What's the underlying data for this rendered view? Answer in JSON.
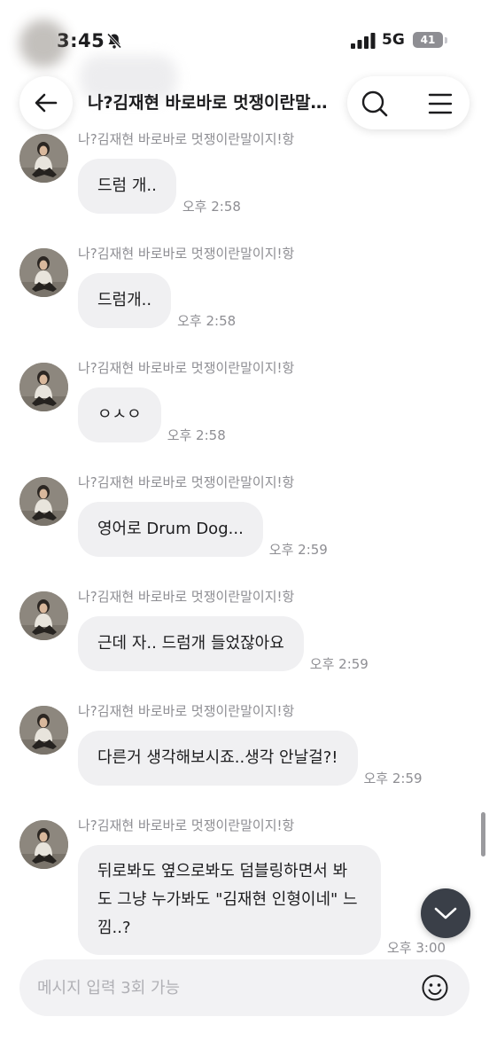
{
  "status_bar": {
    "time": "3:45",
    "network": "5G",
    "battery": "41"
  },
  "header": {
    "title": "나?김재현 바로바로 멋쟁이란말이지!항",
    "back_icon": "arrow-left-icon",
    "search_icon": "search-icon",
    "menu_icon": "menu-icon"
  },
  "messages": [
    {
      "sender": "나?김재현 바로바로 멋쟁이란말이지!항",
      "text": "드럼 개..",
      "time": "오후 2:58"
    },
    {
      "sender": "나?김재현 바로바로 멋쟁이란말이지!항",
      "text": "드럼개..",
      "time": "오후 2:58"
    },
    {
      "sender": "나?김재현 바로바로 멋쟁이란말이지!항",
      "text": "ㅇㅅㅇ",
      "time": "오후 2:58"
    },
    {
      "sender": "나?김재현 바로바로 멋쟁이란말이지!항",
      "text": "영어로 Drum Dog...",
      "time": "오후 2:59"
    },
    {
      "sender": "나?김재현 바로바로 멋쟁이란말이지!항",
      "text": "근데 자.. 드럼개 들었잖아요",
      "time": "오후 2:59"
    },
    {
      "sender": "나?김재현 바로바로 멋쟁이란말이지!항",
      "text": "다른거 생각해보시죠..생각 안날걸?!",
      "time": "오후 2:59"
    },
    {
      "sender": "나?김재현 바로바로 멋쟁이란말이지!항",
      "text": "뒤로봐도 옆으로봐도 덤블링하면서 봐도 그냥 누가봐도 \"김재현 인형이네\" 느낌..?",
      "time": "오후 3:00"
    }
  ],
  "input": {
    "placeholder": "메시지 입력 3회 가능",
    "emoji_icon": "smiley-icon"
  },
  "scroll_down_icon": "chevron-down-icon",
  "colors": {
    "bubble": "#f0f0f2",
    "muted_text": "#8e8e93",
    "fab": "#3a3f48"
  }
}
